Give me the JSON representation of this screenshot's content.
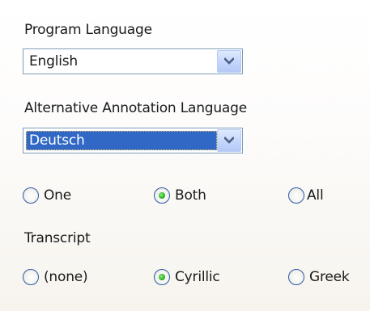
{
  "program_language": {
    "label": "Program Language",
    "selected": "English"
  },
  "annotation_language": {
    "label": "Alternative Annotation Language",
    "selected": "Deutsch"
  },
  "count_options": {
    "options": [
      "One",
      "Both",
      "All"
    ],
    "selected": "Both"
  },
  "transcript": {
    "label": "Transcript",
    "options": [
      "(none)",
      "Cyrillic",
      "Greek"
    ],
    "selected": "Cyrillic"
  },
  "colors": {
    "selection_highlight": "#3168c5",
    "radio_dot": "#2fb42a",
    "combo_border": "#7f9db9"
  },
  "icons": {
    "dropdown": "chevron-down-icon"
  }
}
